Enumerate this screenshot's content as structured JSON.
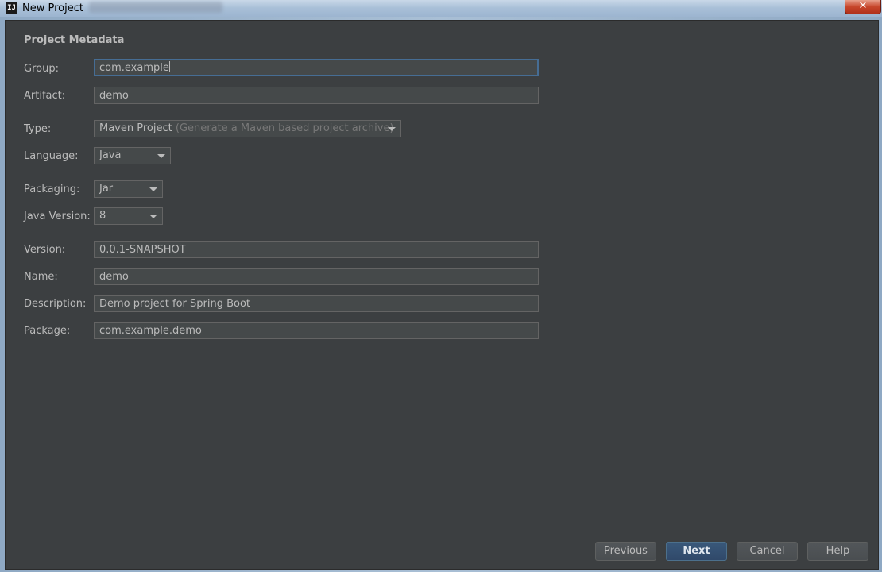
{
  "window": {
    "title": "New Project",
    "app_icon": "IJ",
    "close_label": "✕"
  },
  "form": {
    "section_title": "Project Metadata",
    "group": {
      "label": "Group:",
      "value": "com.example"
    },
    "artifact": {
      "label": "Artifact:",
      "value": "demo"
    },
    "type": {
      "label": "Type:",
      "value": "Maven Project",
      "hint": "(Generate a Maven based project archive)"
    },
    "language": {
      "label": "Language:",
      "value": "Java"
    },
    "packaging": {
      "label": "Packaging:",
      "value": "Jar"
    },
    "java_version": {
      "label": "Java Version:",
      "value": "8"
    },
    "version": {
      "label": "Version:",
      "value": "0.0.1-SNAPSHOT"
    },
    "name": {
      "label": "Name:",
      "value": "demo"
    },
    "description": {
      "label": "Description:",
      "value": "Demo project for Spring Boot"
    },
    "package": {
      "label": "Package:",
      "value": "com.example.demo"
    }
  },
  "buttons": {
    "previous": "Previous",
    "next": "Next",
    "cancel": "Cancel",
    "help": "Help"
  },
  "colors": {
    "background": "#3c3f41",
    "field_bg": "#45494a",
    "text": "#bbbbbb",
    "focus_border": "#466d94",
    "primary_button": "#365880"
  }
}
